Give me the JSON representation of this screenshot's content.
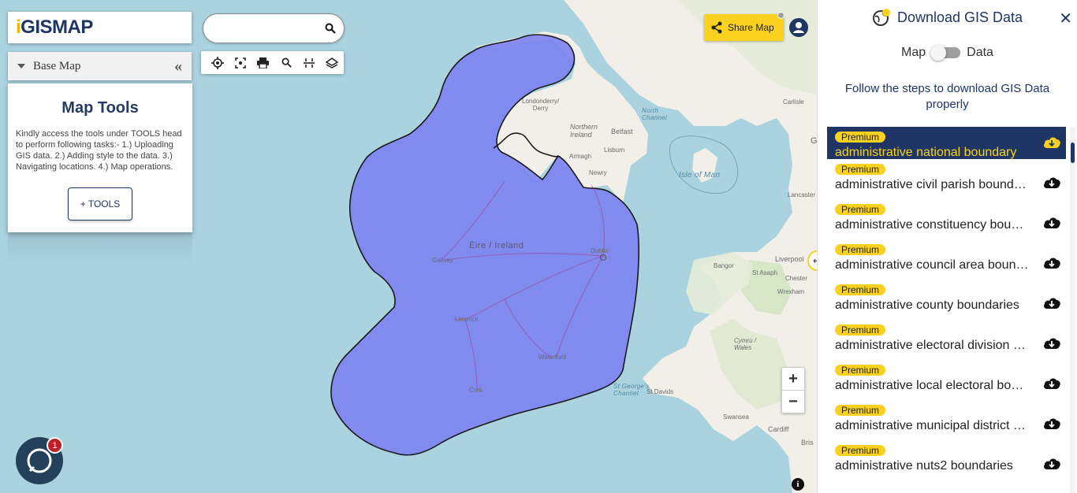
{
  "app": {
    "logo_text": "GISMAP",
    "logo_accent": "i"
  },
  "base_map": {
    "label": "Base Map",
    "collapse_glyph": "«"
  },
  "map_tools": {
    "title": "Map Tools",
    "description": "Kindly access the tools under TOOLS head to perform following tasks:- 1.) Uploading GIS data. 2.) Adding style to the data. 3.) Navigating locations. 4.) Map operations.",
    "button_label": "+ TOOLS"
  },
  "search": {
    "value": "",
    "placeholder": ""
  },
  "toolbar": {
    "icons": [
      "locate-icon",
      "fullscreen-icon",
      "print-icon",
      "zoom-search-icon",
      "measure-icon",
      "layers-icon"
    ]
  },
  "share": {
    "label": "Share Map"
  },
  "map": {
    "labels": [
      {
        "text": "Londonderry/\nDerry",
        "kind": "place"
      },
      {
        "text": "Northern\nIreland",
        "kind": "place"
      },
      {
        "text": "Belfast",
        "kind": "place"
      },
      {
        "text": "Lisburn",
        "kind": "place"
      },
      {
        "text": "Armagh",
        "kind": "place"
      },
      {
        "text": "Newry",
        "kind": "place"
      },
      {
        "text": "North\nChannel",
        "kind": "sea"
      },
      {
        "text": "Isle of Man",
        "kind": "sea"
      },
      {
        "text": "Éire / Ireland",
        "kind": "country"
      },
      {
        "text": "Galway",
        "kind": "place"
      },
      {
        "text": "Dublin",
        "kind": "place"
      },
      {
        "text": "Limerick",
        "kind": "place"
      },
      {
        "text": "Waterford",
        "kind": "place"
      },
      {
        "text": "Cork",
        "kind": "place"
      },
      {
        "text": "Carlisle",
        "kind": "place"
      },
      {
        "text": "Lancaster",
        "kind": "place"
      },
      {
        "text": "Liverpool",
        "kind": "place"
      },
      {
        "text": "Bangor",
        "kind": "place"
      },
      {
        "text": "St Asaph",
        "kind": "place"
      },
      {
        "text": "Chester",
        "kind": "place"
      },
      {
        "text": "Wrexham",
        "kind": "place"
      },
      {
        "text": "Cymru /\nWales",
        "kind": "place"
      },
      {
        "text": "St George's\nChannel",
        "kind": "sea"
      },
      {
        "text": "St Davids",
        "kind": "place"
      },
      {
        "text": "Swansea",
        "kind": "place"
      },
      {
        "text": "Cardiff",
        "kind": "place"
      },
      {
        "text": "Bris",
        "kind": "place"
      },
      {
        "text": "G",
        "kind": "place"
      }
    ],
    "zoom_in": "+",
    "zoom_out": "−",
    "info": "i"
  },
  "chat": {
    "badge_count": "1"
  },
  "panel": {
    "title": "Download GIS Data",
    "close": "✕",
    "toggle_left": "Map",
    "toggle_right": "Data",
    "instructions": "Follow the steps to download GIS Data properly",
    "datasets": [
      {
        "badge": "Premium",
        "name": "administrative national boundary"
      },
      {
        "badge": "Premium",
        "name": "administrative civil parish boundaries"
      },
      {
        "badge": "Premium",
        "name": "administrative constituency boundaries"
      },
      {
        "badge": "Premium",
        "name": "administrative council area boundaries"
      },
      {
        "badge": "Premium",
        "name": "administrative county boundaries"
      },
      {
        "badge": "Premium",
        "name": "administrative electoral division boundaries"
      },
      {
        "badge": "Premium",
        "name": "administrative local electoral boundaries"
      },
      {
        "badge": "Premium",
        "name": "administrative municipal district boundaries"
      },
      {
        "badge": "Premium",
        "name": "administrative nuts2 boundaries"
      }
    ]
  },
  "colors": {
    "brand": "#1f3664",
    "accent": "#f9d11e",
    "boundary_fill": "#7b7ff0",
    "sea": "#aad3df"
  }
}
